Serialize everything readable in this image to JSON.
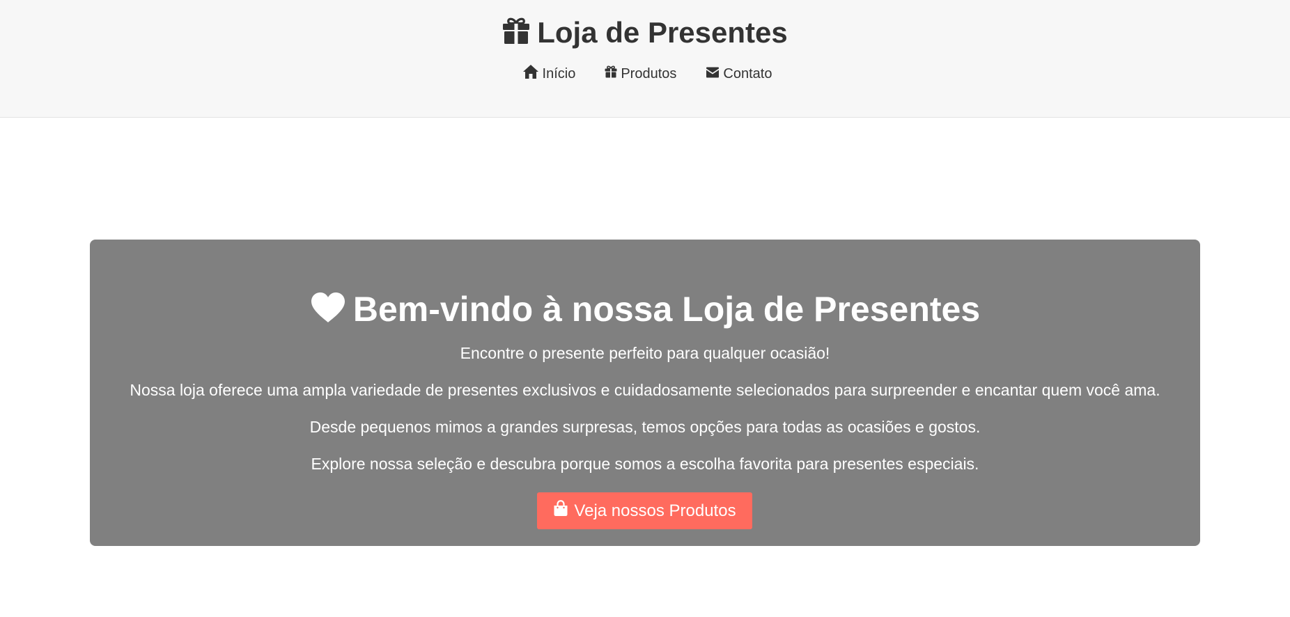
{
  "header": {
    "title": "Loja de Presentes",
    "title_icon": "gift-icon",
    "nav": [
      {
        "label": "Início",
        "icon": "home-icon"
      },
      {
        "label": "Produtos",
        "icon": "gift-icon"
      },
      {
        "label": "Contato",
        "icon": "envelope-icon"
      }
    ]
  },
  "hero": {
    "title": "Bem-vindo à nossa Loja de Presentes",
    "title_icon": "heart-icon",
    "paragraphs": [
      "Encontre o presente perfeito para qualquer ocasião!",
      "Nossa loja oferece uma ampla variedade de presentes exclusivos e cuidadosamente selecionados para surpreender e encantar quem você ama.",
      "Desde pequenos mimos a grandes surpresas, temos opções para todas as ocasiões e gostos.",
      "Explore nossa seleção e descubra porque somos a escolha favorita para presentes especiais."
    ],
    "cta_label": "Veja nossos Produtos",
    "cta_icon": "shopping-bag-icon"
  },
  "colors": {
    "header_bg": "#f7f7f7",
    "hero_bg": "#808080",
    "cta_bg": "#ff6b5e",
    "text_dark": "#333333",
    "text_light": "#ffffff"
  }
}
